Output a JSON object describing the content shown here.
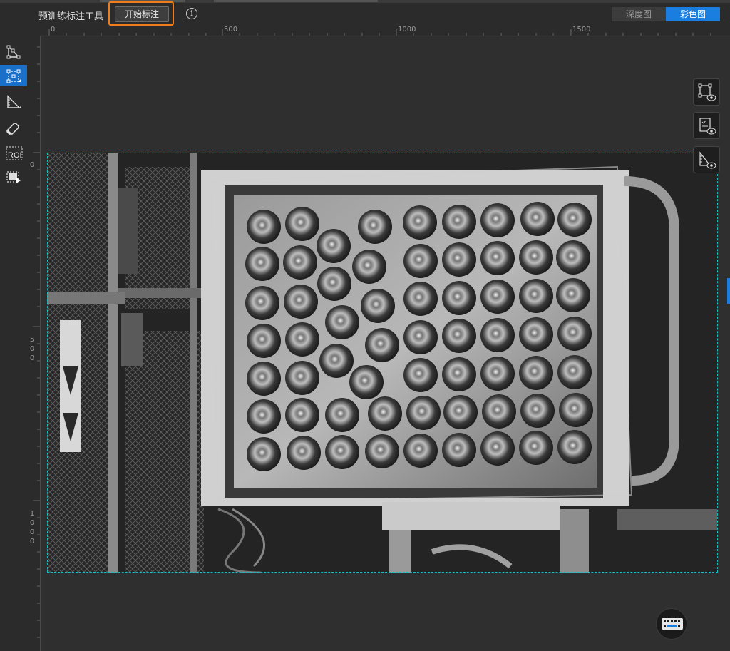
{
  "header": {
    "tool_title": "预训练标注工具",
    "start_button_label": "开始标注",
    "info_glyph": "i",
    "view_tabs": [
      {
        "label": "深度图",
        "active": false
      },
      {
        "label": "彩色图",
        "active": true
      }
    ]
  },
  "left_toolbar": {
    "tools": [
      {
        "name": "polygon-tool-icon",
        "active": false
      },
      {
        "name": "node-edit-tool-icon",
        "active": true
      },
      {
        "name": "ruler-angle-tool-icon",
        "active": false
      },
      {
        "name": "eraser-tool-icon",
        "active": false
      },
      {
        "name": "roi-tool-icon",
        "label": "ROI",
        "active": false
      },
      {
        "name": "play-region-tool-icon",
        "active": false
      }
    ]
  },
  "ruler": {
    "top_labels": [
      "0",
      "500",
      "1000",
      "1500"
    ],
    "left_labels": [
      "0",
      "500",
      "1000"
    ]
  },
  "right_float_buttons": [
    {
      "name": "show-polygons-eye-icon"
    },
    {
      "name": "show-labels-eye-icon"
    },
    {
      "name": "show-region-eye-icon"
    }
  ],
  "colors": {
    "accent": "#1a7ee0",
    "highlight_border": "#ee7d1e",
    "roi_dash": "#19c0c0",
    "background": "#2b2b2b"
  }
}
